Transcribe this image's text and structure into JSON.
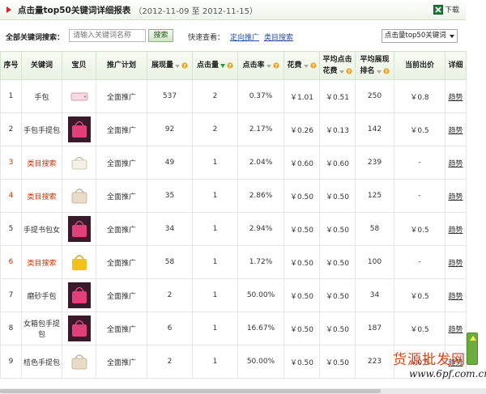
{
  "report": {
    "title": "点击量top50关键词详细报表",
    "date_range": "（2012-11-09 至 2012-11-15）",
    "download_label": "下载"
  },
  "search": {
    "label": "全部关键词搜索：",
    "placeholder": "请输入关键词名称",
    "button_label": "搜索",
    "quick_view_label": "快速查看：",
    "quick_links": [
      "定向推广",
      "类目搜索"
    ],
    "select_value": "点击量top50关键词"
  },
  "table": {
    "headers": {
      "no": "序号",
      "keyword": "关键词",
      "item": "宝贝",
      "plan": "推广计划",
      "impressions": "展现量",
      "clicks": "点击量",
      "ctr": "点击率",
      "cost": "花费",
      "avg_cpc_1": "平均点击",
      "avg_cpc_2": "花费",
      "avg_rank_1": "平均展现",
      "avg_rank_2": "排名",
      "bid": "当前出价",
      "detail": "详细"
    },
    "rows": [
      {
        "no": "1",
        "keyword": "手包",
        "plan": "全面推广",
        "impressions": "537",
        "clicks": "2",
        "ctr": "0.37%",
        "cost": "￥1.01",
        "avg_cpc": "￥0.51",
        "avg_rank": "250",
        "bid": "￥0.8",
        "detail": "趋势",
        "keyword_red": false,
        "thumb": "wallet"
      },
      {
        "no": "2",
        "keyword": "手包手提包",
        "plan": "全面推广",
        "impressions": "92",
        "clicks": "2",
        "ctr": "2.17%",
        "cost": "￥0.26",
        "avg_cpc": "￥0.13",
        "avg_rank": "142",
        "bid": "￥0.5",
        "detail": "趋势",
        "keyword_red": false,
        "thumb": "pink"
      },
      {
        "no": "3",
        "keyword": "类目搜索",
        "plan": "全面推广",
        "impressions": "49",
        "clicks": "1",
        "ctr": "2.04%",
        "cost": "￥0.60",
        "avg_cpc": "￥0.60",
        "avg_rank": "239",
        "bid": "-",
        "detail": "趋势",
        "keyword_red": true,
        "thumb": "white"
      },
      {
        "no": "4",
        "keyword": "类目搜索",
        "plan": "全面推广",
        "impressions": "35",
        "clicks": "1",
        "ctr": "2.86%",
        "cost": "￥0.50",
        "avg_cpc": "￥0.50",
        "avg_rank": "125",
        "bid": "-",
        "detail": "趋势",
        "keyword_red": true,
        "thumb": "beige"
      },
      {
        "no": "5",
        "keyword": "手提书包女",
        "plan": "全面推广",
        "impressions": "34",
        "clicks": "1",
        "ctr": "2.94%",
        "cost": "￥0.50",
        "avg_cpc": "￥0.50",
        "avg_rank": "58",
        "bid": "￥0.5",
        "detail": "趋势",
        "keyword_red": false,
        "thumb": "pink"
      },
      {
        "no": "6",
        "keyword": "类目搜索",
        "plan": "全面推广",
        "impressions": "58",
        "clicks": "1",
        "ctr": "1.72%",
        "cost": "￥0.50",
        "avg_cpc": "￥0.50",
        "avg_rank": "100",
        "bid": "-",
        "detail": "趋势",
        "keyword_red": true,
        "thumb": "yellow"
      },
      {
        "no": "7",
        "keyword": "磨砂手包",
        "plan": "全面推广",
        "impressions": "2",
        "clicks": "1",
        "ctr": "50.00%",
        "cost": "￥0.50",
        "avg_cpc": "￥0.50",
        "avg_rank": "34",
        "bid": "￥0.5",
        "detail": "趋势",
        "keyword_red": false,
        "thumb": "pink"
      },
      {
        "no": "8",
        "keyword": "女箱包手提包",
        "plan": "全面推广",
        "impressions": "6",
        "clicks": "1",
        "ctr": "16.67%",
        "cost": "￥0.50",
        "avg_cpc": "￥0.50",
        "avg_rank": "187",
        "bid": "￥0.5",
        "detail": "趋势",
        "keyword_red": false,
        "thumb": "pink"
      },
      {
        "no": "9",
        "keyword": "桔色手提包",
        "plan": "全面推广",
        "impressions": "2",
        "clicks": "1",
        "ctr": "50.00%",
        "cost": "￥0.50",
        "avg_cpc": "￥0.50",
        "avg_rank": "223",
        "bid": "￥0.5",
        "detail": "趋势",
        "keyword_red": false,
        "thumb": "beige"
      }
    ]
  },
  "watermark": {
    "line1": "货源批发网",
    "line2": "www.6pf.com.cn"
  },
  "colors": {
    "accent_green": "#6cae3d",
    "keyword_red": "#cc3300",
    "pink_bag": "#e33f7a",
    "yellow_bag": "#f2c21b"
  }
}
